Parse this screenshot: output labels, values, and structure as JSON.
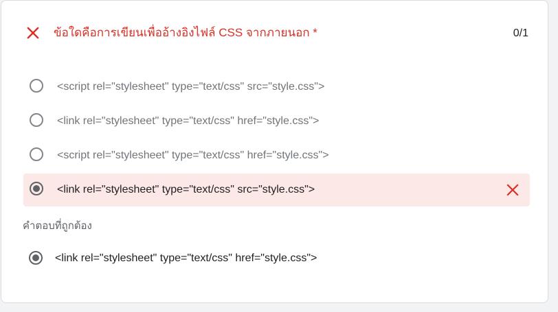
{
  "question": {
    "title": "ข้อใดคือการเขียนเพื่ออ้างอิงไฟล์ CSS จากภายนอก *",
    "score": "0/1",
    "status_icon": "close-icon",
    "status_color": "#d93025"
  },
  "options": [
    {
      "label": "<script rel=\"stylesheet\" type=\"text/css\" src=\"style.css\">",
      "selected": false
    },
    {
      "label": "<link rel=\"stylesheet\" type=\"text/css\" href=\"style.css\">",
      "selected": false
    },
    {
      "label": "<script rel=\"stylesheet\" type=\"text/css\" href=\"style.css\">",
      "selected": false
    },
    {
      "label": "<link rel=\"stylesheet\" type=\"text/css\" src=\"style.css\">",
      "selected": true,
      "incorrect": true
    }
  ],
  "correct_answer": {
    "title": "คำตอบที่ถูกต้อง",
    "label": "<link rel=\"stylesheet\" type=\"text/css\" href=\"style.css\">"
  },
  "colors": {
    "wrong_background": "#fce8e6",
    "error_red": "#d93025"
  }
}
